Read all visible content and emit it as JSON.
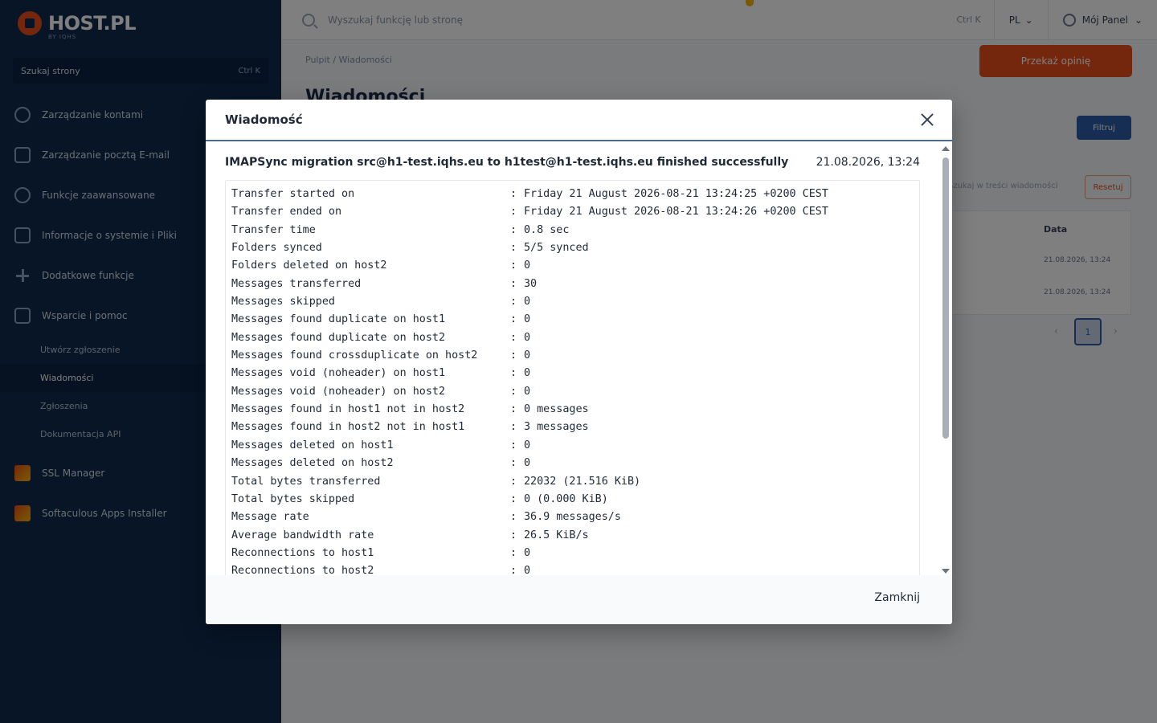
{
  "sidebar": {
    "logo_text": "HOST.PL",
    "logo_sub": "BY IQHS",
    "search_placeholder": "Szukaj strony",
    "search_kbd": "Ctrl K",
    "items": [
      {
        "label": "Zarządzanie kontami",
        "icon": "user-icon"
      },
      {
        "label": "Zarządzanie pocztą E-mail",
        "icon": "mail-icon"
      },
      {
        "label": "Funkcje zaawansowane",
        "icon": "settings-icon"
      },
      {
        "label": "Informacje o systemie i Pliki",
        "icon": "folder-icon"
      },
      {
        "label": "Dodatkowe funkcje",
        "icon": "plus-icon"
      },
      {
        "label": "Wsparcie i pomoc",
        "icon": "help-icon"
      }
    ],
    "sub_items": [
      {
        "label": "Utwórz zgłoszenie"
      },
      {
        "label": "Wiadomości"
      },
      {
        "label": "Zgłoszenia"
      },
      {
        "label": "Dokumentacja API"
      }
    ],
    "extra_items": [
      {
        "label": "SSL Manager"
      },
      {
        "label": "Softaculous Apps Installer"
      }
    ]
  },
  "topbar": {
    "search_placeholder": "Wyszukaj funkcję lub stronę",
    "search_kbd": "Ctrl K",
    "lang": "PL",
    "user": "Mój Panel"
  },
  "content": {
    "breadcrumb": "Pulpit / Wiadomości",
    "cta_label": "Przekaż opinię",
    "page_title": "Wiadomości",
    "blue_button": "Filtruj",
    "filter_text": "Szukaj w treści wiadomości",
    "filter_button": "Resetuj",
    "table_header_date": "Data",
    "table_dates": [
      "21.08.2026, 13:24",
      "21.08.2026, 13:24"
    ],
    "pager_page": "1"
  },
  "modal": {
    "title": "Wiadomość",
    "subject": "IMAPSync migration src@h1-test.iqhs.eu to h1test@h1-test.iqhs.eu finished successfully",
    "date": "21.08.2026, 13:24",
    "log": [
      {
        "key": "Transfer started on",
        "value": "Friday 21 August 2026-08-21 13:24:25 +0200 CEST"
      },
      {
        "key": "Transfer ended on",
        "value": "Friday 21 August 2026-08-21 13:24:26 +0200 CEST"
      },
      {
        "key": "Transfer time",
        "value": "0.8 sec"
      },
      {
        "key": "Folders synced",
        "value": "5/5 synced"
      },
      {
        "key": "Folders deleted on host2",
        "value": "0"
      },
      {
        "key": "Messages transferred",
        "value": "30"
      },
      {
        "key": "Messages skipped",
        "value": "0"
      },
      {
        "key": "Messages found duplicate on host1",
        "value": "0"
      },
      {
        "key": "Messages found duplicate on host2",
        "value": "0"
      },
      {
        "key": "Messages found crossduplicate on host2",
        "value": "0"
      },
      {
        "key": "Messages void (noheader) on host1",
        "value": "0"
      },
      {
        "key": "Messages void (noheader) on host2",
        "value": "0"
      },
      {
        "key": "Messages found in host1 not in host2",
        "value": "0 messages"
      },
      {
        "key": "Messages found in host2 not in host1",
        "value": "3 messages"
      },
      {
        "key": "Messages deleted on host1",
        "value": "0"
      },
      {
        "key": "Messages deleted on host2",
        "value": "0"
      },
      {
        "key": "Total bytes transferred",
        "value": "22032 (21.516 KiB)"
      },
      {
        "key": "Total bytes skipped",
        "value": "0 (0.000 KiB)"
      },
      {
        "key": "Message rate",
        "value": "36.9 messages/s"
      },
      {
        "key": "Average bandwidth rate",
        "value": "26.5 KiB/s"
      },
      {
        "key": "Reconnections to host1",
        "value": "0"
      },
      {
        "key": "Reconnections to host2",
        "value": "0"
      }
    ],
    "separator": ":",
    "close_label": "Zamknij"
  }
}
